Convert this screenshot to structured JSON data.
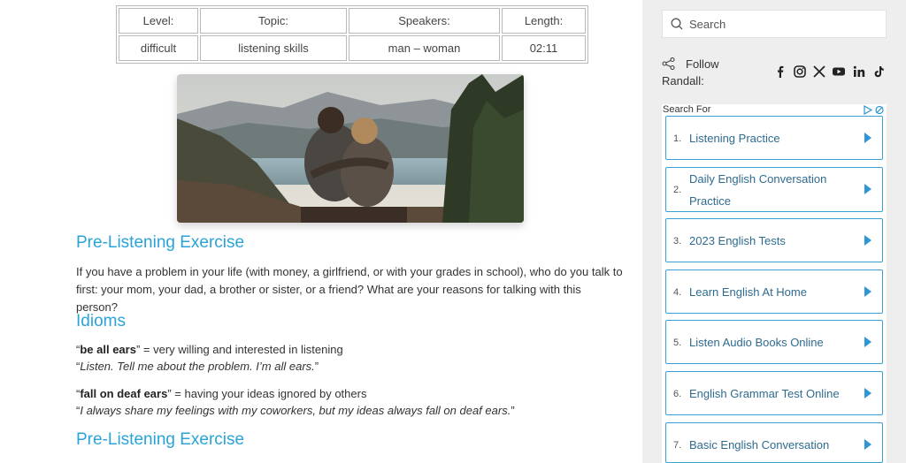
{
  "table": {
    "headers": [
      "Level:",
      "Topic:",
      "Speakers:",
      "Length:"
    ],
    "values": [
      "difficult",
      "listening skills",
      "man – woman",
      "02:11"
    ]
  },
  "photo": {
    "alt": "couple"
  },
  "section1": {
    "heading": "Pre-Listening Exercise",
    "line1": "If you have a problem in your life (with money, a girlfriend, or with your grades in school), who do you talk to",
    "line2": "first: your mom, your dad, a brother or sister, or a friend? What are your reasons for talking with this person?"
  },
  "idioms": {
    "heading": "Idioms",
    "items": [
      {
        "term": "be all ears",
        "definition": " = very willing and interested in listening",
        "example": "Listen. Tell me about the problem. I’m all ears."
      },
      {
        "term": "fall on deaf ears",
        "definition": " = having your ideas ignored by others",
        "example": "I always share my feelings with my coworkers, but my ideas always fall on deaf ears."
      }
    ]
  },
  "section2": {
    "heading": "Pre-Listening Exercise"
  },
  "sidebar": {
    "search_placeholder": "Search",
    "follow_line1": "Follow",
    "follow_line2": "Randall:",
    "social": [
      "facebook-icon",
      "instagram-icon",
      "x-icon",
      "youtube-icon",
      "linkedin-icon",
      "tiktok-icon"
    ],
    "ads": {
      "title": "Search For",
      "items": [
        {
          "num": "1.",
          "label": "Listening Practice"
        },
        {
          "num": "2.",
          "label1": "Daily English Conversation",
          "label2": "Practice"
        },
        {
          "num": "3.",
          "label": "2023 English Tests"
        },
        {
          "num": "4.",
          "label": "Learn English At Home"
        },
        {
          "num": "5.",
          "label": "Listen Audio Books Online"
        },
        {
          "num": "6.",
          "label": "English Grammar Test Online"
        },
        {
          "num": "7.",
          "label": "Basic English Conversation"
        }
      ]
    }
  },
  "colors": {
    "accent": "#2aa3d8",
    "ad_border": "#3aa0d1",
    "sidebar_bg": "#eeeeee"
  }
}
